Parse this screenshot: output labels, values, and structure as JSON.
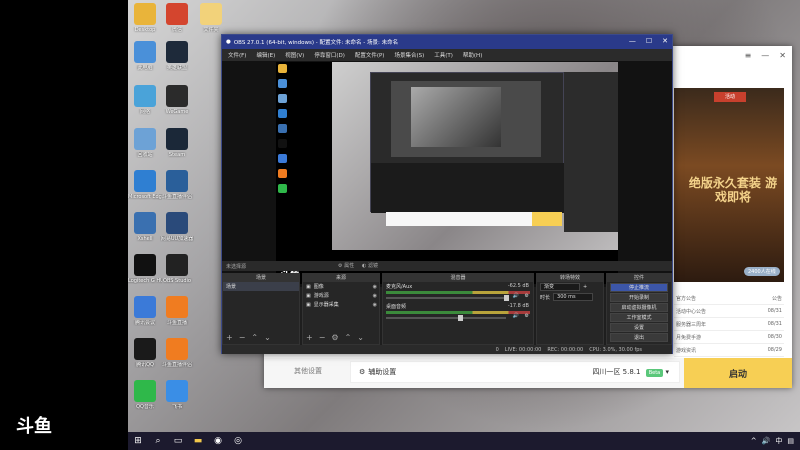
{
  "brand": "斗鱼",
  "desktop_icons": [
    {
      "label": "Desktop",
      "icon": "app-icon",
      "color": "#e9b43a"
    },
    {
      "label": "微信",
      "icon": "app-icon",
      "color": "#d4452e"
    },
    {
      "label": "文件夹",
      "icon": "folder-icon",
      "color": "#f2d27a"
    },
    {
      "label": "此电脑",
      "icon": "computer-icon",
      "color": "#4a90d9"
    },
    {
      "label": "英雄联盟",
      "icon": "game-icon",
      "color": "#1e2a3a"
    },
    {
      "label": "网络",
      "icon": "network-icon",
      "color": "#4aa3d9"
    },
    {
      "label": "WeGame",
      "icon": "game-icon",
      "color": "#2b2b2b"
    },
    {
      "label": "回收站",
      "icon": "recycle-icon",
      "color": "#6da2d6"
    },
    {
      "label": "Steam",
      "icon": "steam-icon",
      "color": "#1b2838"
    },
    {
      "label": "Microsoft Edge",
      "icon": "edge-icon",
      "color": "#2f7fd2"
    },
    {
      "label": "斗鱼直播伴侣",
      "icon": "app-icon",
      "color": "#2a5f9a"
    },
    {
      "label": "Xshell",
      "icon": "app-icon",
      "color": "#3a70b0"
    },
    {
      "label": "网易UU加速器",
      "icon": "app-icon",
      "color": "#2a4a7a"
    },
    {
      "label": "Logitech G HUB",
      "icon": "logitech-icon",
      "color": "#111"
    },
    {
      "label": "OBS Studio",
      "icon": "obs-icon",
      "color": "#222"
    },
    {
      "label": "腾讯会议",
      "icon": "app-icon",
      "color": "#3b7ad8"
    },
    {
      "label": "斗鱼直播",
      "icon": "app-icon",
      "color": "#f07c20"
    },
    {
      "label": "腾讯QQ",
      "icon": "qq-icon",
      "color": "#1a1a1a"
    },
    {
      "label": "斗鱼直播伴侣",
      "icon": "app-icon",
      "color": "#f07c20"
    },
    {
      "label": "QQ音乐",
      "icon": "music-icon",
      "color": "#2fb84a"
    },
    {
      "label": "飞书",
      "icon": "app-icon",
      "color": "#3a8ee6"
    }
  ],
  "taskbar": {
    "items": [
      "start-icon",
      "search-icon",
      "task-view-icon",
      "explorer-icon",
      "obs-icon",
      "app-icon"
    ],
    "time": "",
    "colors": {
      "bg": "#1c1a2e"
    }
  },
  "launcher": {
    "badge": "活动",
    "banner_title": "绝版永久套装 游戏即将",
    "list": [
      {
        "left": "官方公告",
        "right": "公告"
      },
      {
        "left": "活动中心公告",
        "right": "08/31"
      },
      {
        "left": "服务器三周年",
        "right": "08/31"
      },
      {
        "left": "月免费手游",
        "right": "08/30"
      },
      {
        "left": "游戏资讯",
        "right": "08/29"
      }
    ],
    "pill": "2400人在线",
    "bottom_left": "其他设置",
    "assist": "辅助设置",
    "server": "四川一区 5.8.1",
    "server_tag": "Beta",
    "launch": "启动"
  },
  "obs": {
    "title": "OBS 27.0.1 (64-bit, windows) - 配置文件: 未命名 - 场景: 未命名",
    "menu": [
      "文件(F)",
      "编辑(E)",
      "视图(V)",
      "停靠窗口(D)",
      "配置文件(P)",
      "场景集合(S)",
      "工具(T)",
      "帮助(H)"
    ],
    "scene_label": "未选择源",
    "props_btn": "属性",
    "filters_btn": "滤镜",
    "panels": {
      "scenes": {
        "title": "场景",
        "items": [
          "场景"
        ]
      },
      "sources": {
        "title": "来源",
        "items": [
          "图像",
          "游戏源",
          "显示器采集"
        ]
      },
      "mixer": {
        "title": "混音器",
        "channels": [
          {
            "name": "麦克风/Aux",
            "db": "-62.5 dB",
            "fill": 0.6
          },
          {
            "name": "桌面音频",
            "db": "-17.8 dB",
            "fill": 0.75
          }
        ]
      },
      "transitions": {
        "title": "转场特效",
        "type": "渐变",
        "duration_label": "时长",
        "duration": "300 ms"
      },
      "controls": {
        "title": "控件",
        "buttons": [
          "停止推流",
          "开始录制",
          "启动虚拟摄像机",
          "工作室模式",
          "设置",
          "退出"
        ]
      }
    },
    "status": {
      "drop": "0",
      "live": "LIVE: 00:00:00",
      "rec": "REC: 00:00:00",
      "cpu": "CPU: 3.0%, 30.00 fps"
    }
  }
}
